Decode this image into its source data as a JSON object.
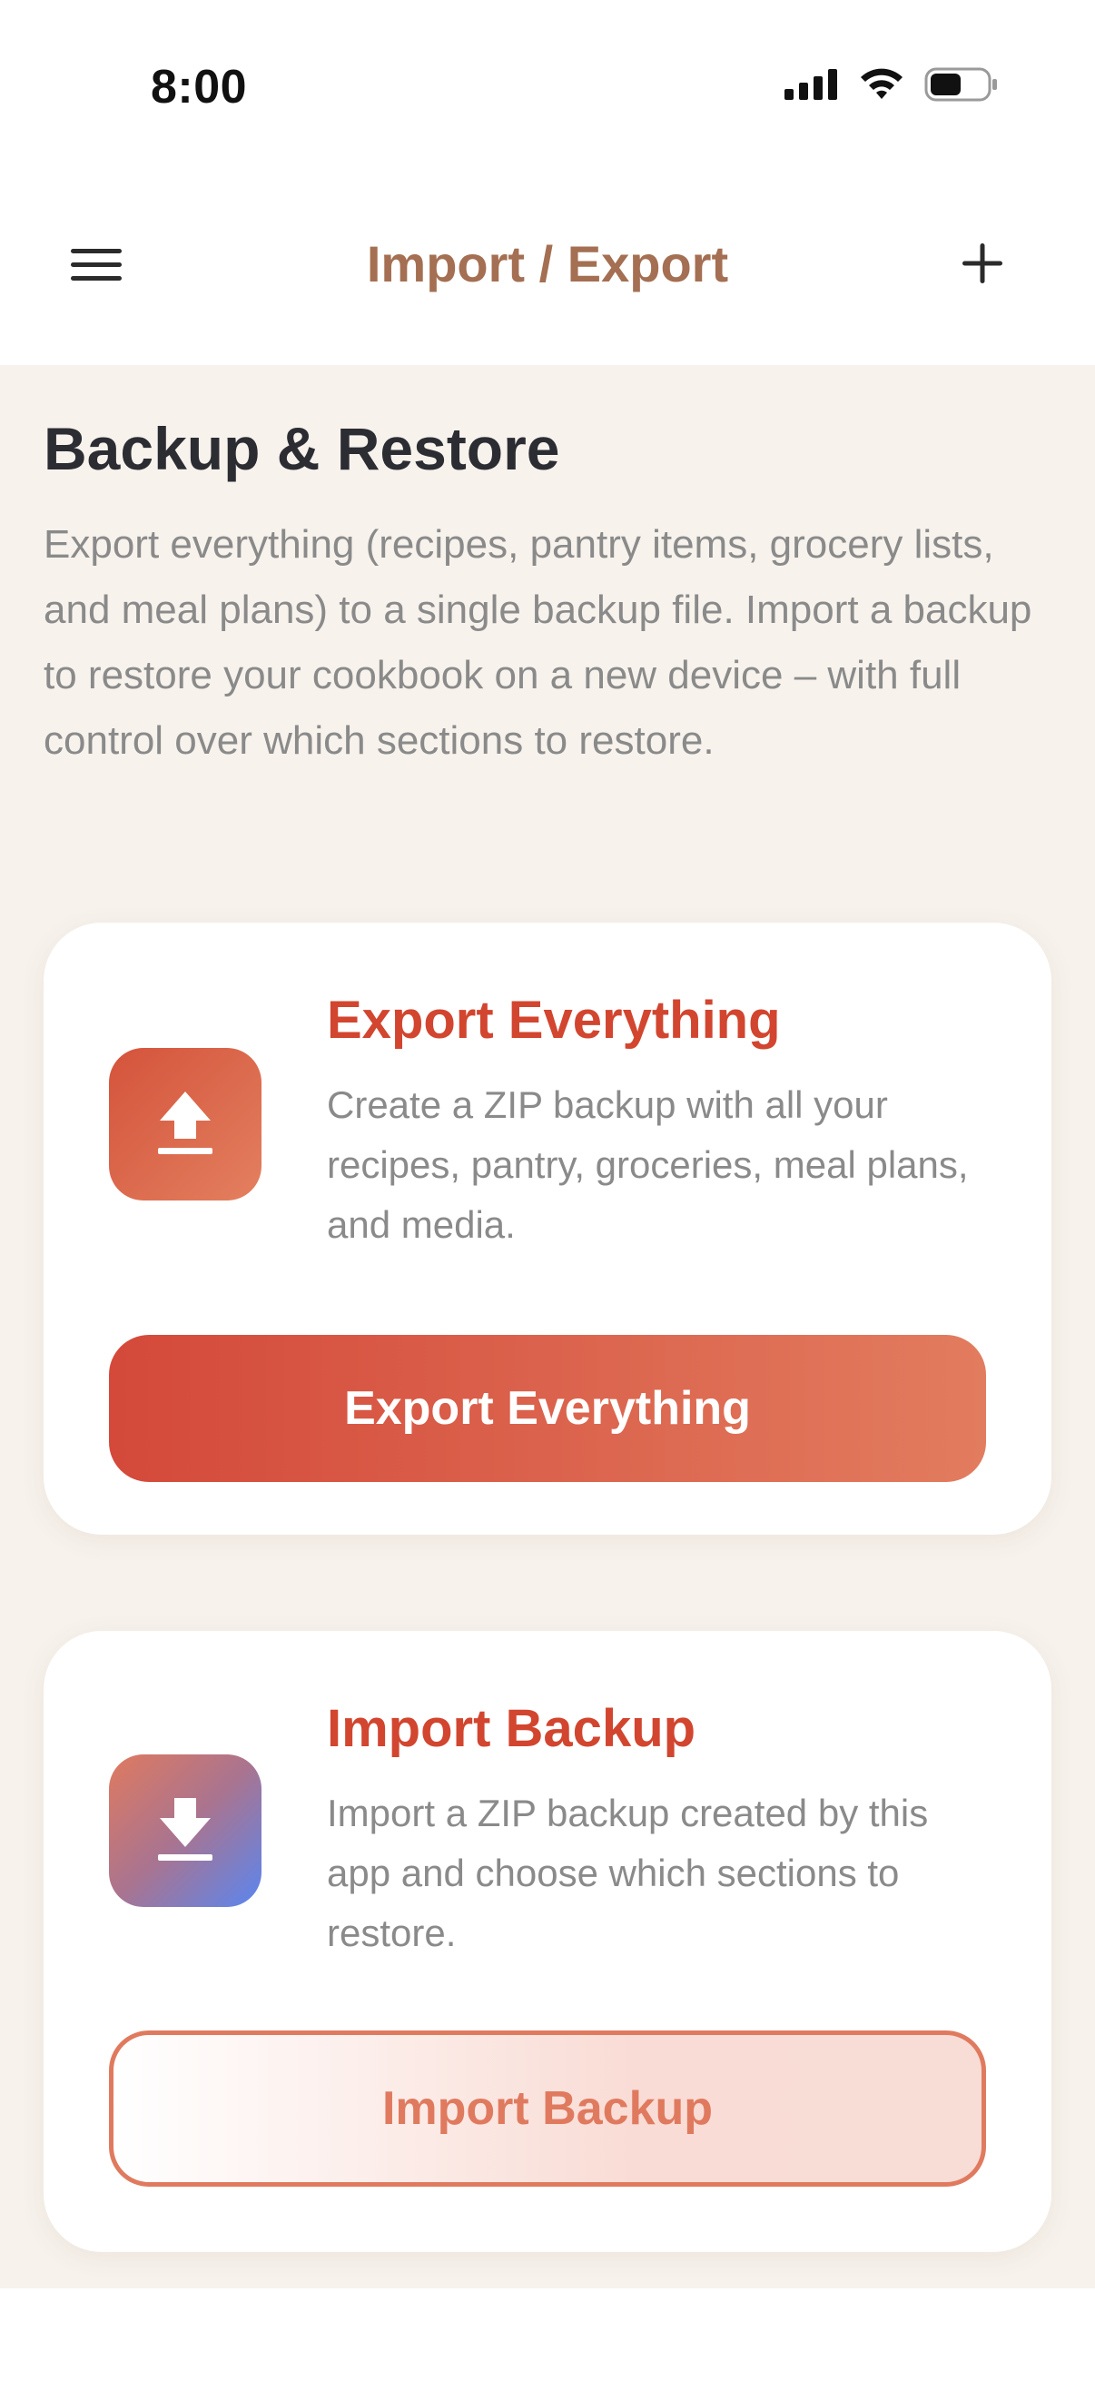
{
  "status_bar": {
    "time": "8:00"
  },
  "nav": {
    "title": "Import / Export",
    "menu_icon": "hamburger-menu-icon",
    "add_icon": "plus-icon"
  },
  "intro": {
    "title": "Backup & Restore",
    "description": "Export everything (recipes, pantry items, grocery lists, and meal plans) to a single backup file. Import a backup to restore your cookbook on a new device – with full control over which sections to restore."
  },
  "export_card": {
    "icon": "upload-icon",
    "title": "Export Everything",
    "description": "Create a ZIP backup with all your recipes, pantry, groceries, meal plans, and media.",
    "button_label": "Export Everything"
  },
  "import_card": {
    "icon": "download-icon",
    "title": "Import Backup",
    "description": "Import a ZIP backup created by this app and choose which sections to restore.",
    "button_label": "Import Backup"
  },
  "colors": {
    "accent": "#d2452f",
    "nav_title": "#a46f52",
    "background": "#f7f2ec",
    "secondary_text": "#8a8a8a"
  }
}
